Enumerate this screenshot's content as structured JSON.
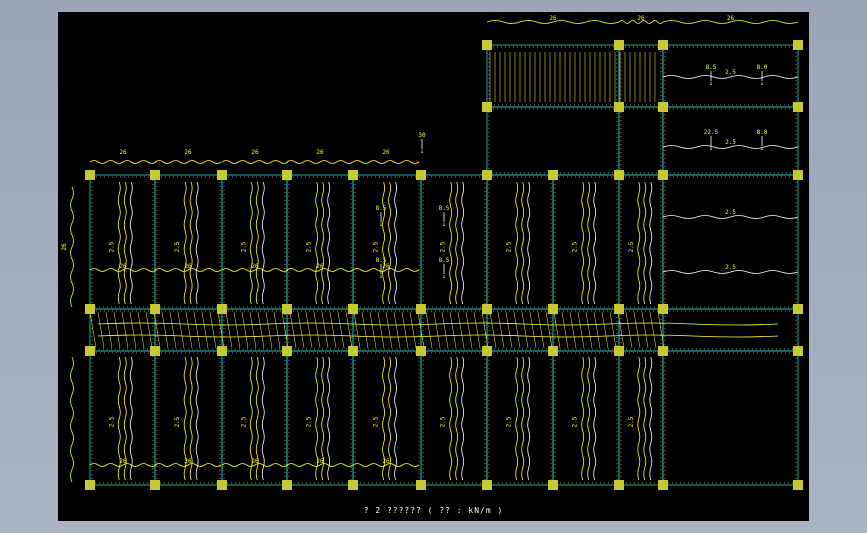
{
  "caption": "? 2 ?????? ( ?? : kN/m )",
  "colors": {
    "background": "#a5b0bf",
    "drawing_area": "#000000",
    "grid": "#2fd3c0",
    "load": "#ffff33",
    "load_alt": "#ffffff",
    "column": "#c8c832"
  },
  "load_labels": {
    "beam_load": "26",
    "span_load": "2.5",
    "point_load": "30",
    "alt_load_a": "8.5",
    "alt_load_b": "4.5",
    "alt_load_c": "8.0",
    "alt_load_d": "22.5"
  },
  "arrow_glyph": "↓"
}
